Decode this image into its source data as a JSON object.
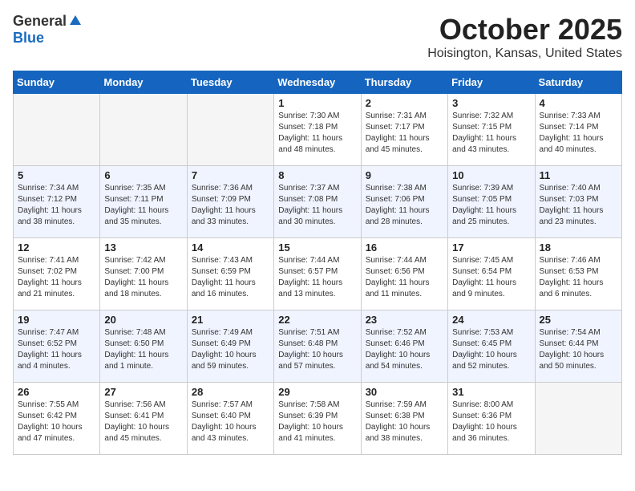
{
  "logo": {
    "general": "General",
    "blue": "Blue"
  },
  "header": {
    "month": "October 2025",
    "location": "Hoisington, Kansas, United States"
  },
  "weekdays": [
    "Sunday",
    "Monday",
    "Tuesday",
    "Wednesday",
    "Thursday",
    "Friday",
    "Saturday"
  ],
  "weeks": [
    [
      {
        "day": "",
        "info": ""
      },
      {
        "day": "",
        "info": ""
      },
      {
        "day": "",
        "info": ""
      },
      {
        "day": "1",
        "info": "Sunrise: 7:30 AM\nSunset: 7:18 PM\nDaylight: 11 hours\nand 48 minutes."
      },
      {
        "day": "2",
        "info": "Sunrise: 7:31 AM\nSunset: 7:17 PM\nDaylight: 11 hours\nand 45 minutes."
      },
      {
        "day": "3",
        "info": "Sunrise: 7:32 AM\nSunset: 7:15 PM\nDaylight: 11 hours\nand 43 minutes."
      },
      {
        "day": "4",
        "info": "Sunrise: 7:33 AM\nSunset: 7:14 PM\nDaylight: 11 hours\nand 40 minutes."
      }
    ],
    [
      {
        "day": "5",
        "info": "Sunrise: 7:34 AM\nSunset: 7:12 PM\nDaylight: 11 hours\nand 38 minutes."
      },
      {
        "day": "6",
        "info": "Sunrise: 7:35 AM\nSunset: 7:11 PM\nDaylight: 11 hours\nand 35 minutes."
      },
      {
        "day": "7",
        "info": "Sunrise: 7:36 AM\nSunset: 7:09 PM\nDaylight: 11 hours\nand 33 minutes."
      },
      {
        "day": "8",
        "info": "Sunrise: 7:37 AM\nSunset: 7:08 PM\nDaylight: 11 hours\nand 30 minutes."
      },
      {
        "day": "9",
        "info": "Sunrise: 7:38 AM\nSunset: 7:06 PM\nDaylight: 11 hours\nand 28 minutes."
      },
      {
        "day": "10",
        "info": "Sunrise: 7:39 AM\nSunset: 7:05 PM\nDaylight: 11 hours\nand 25 minutes."
      },
      {
        "day": "11",
        "info": "Sunrise: 7:40 AM\nSunset: 7:03 PM\nDaylight: 11 hours\nand 23 minutes."
      }
    ],
    [
      {
        "day": "12",
        "info": "Sunrise: 7:41 AM\nSunset: 7:02 PM\nDaylight: 11 hours\nand 21 minutes."
      },
      {
        "day": "13",
        "info": "Sunrise: 7:42 AM\nSunset: 7:00 PM\nDaylight: 11 hours\nand 18 minutes."
      },
      {
        "day": "14",
        "info": "Sunrise: 7:43 AM\nSunset: 6:59 PM\nDaylight: 11 hours\nand 16 minutes."
      },
      {
        "day": "15",
        "info": "Sunrise: 7:44 AM\nSunset: 6:57 PM\nDaylight: 11 hours\nand 13 minutes."
      },
      {
        "day": "16",
        "info": "Sunrise: 7:44 AM\nSunset: 6:56 PM\nDaylight: 11 hours\nand 11 minutes."
      },
      {
        "day": "17",
        "info": "Sunrise: 7:45 AM\nSunset: 6:54 PM\nDaylight: 11 hours\nand 9 minutes."
      },
      {
        "day": "18",
        "info": "Sunrise: 7:46 AM\nSunset: 6:53 PM\nDaylight: 11 hours\nand 6 minutes."
      }
    ],
    [
      {
        "day": "19",
        "info": "Sunrise: 7:47 AM\nSunset: 6:52 PM\nDaylight: 11 hours\nand 4 minutes."
      },
      {
        "day": "20",
        "info": "Sunrise: 7:48 AM\nSunset: 6:50 PM\nDaylight: 11 hours\nand 1 minute."
      },
      {
        "day": "21",
        "info": "Sunrise: 7:49 AM\nSunset: 6:49 PM\nDaylight: 10 hours\nand 59 minutes."
      },
      {
        "day": "22",
        "info": "Sunrise: 7:51 AM\nSunset: 6:48 PM\nDaylight: 10 hours\nand 57 minutes."
      },
      {
        "day": "23",
        "info": "Sunrise: 7:52 AM\nSunset: 6:46 PM\nDaylight: 10 hours\nand 54 minutes."
      },
      {
        "day": "24",
        "info": "Sunrise: 7:53 AM\nSunset: 6:45 PM\nDaylight: 10 hours\nand 52 minutes."
      },
      {
        "day": "25",
        "info": "Sunrise: 7:54 AM\nSunset: 6:44 PM\nDaylight: 10 hours\nand 50 minutes."
      }
    ],
    [
      {
        "day": "26",
        "info": "Sunrise: 7:55 AM\nSunset: 6:42 PM\nDaylight: 10 hours\nand 47 minutes."
      },
      {
        "day": "27",
        "info": "Sunrise: 7:56 AM\nSunset: 6:41 PM\nDaylight: 10 hours\nand 45 minutes."
      },
      {
        "day": "28",
        "info": "Sunrise: 7:57 AM\nSunset: 6:40 PM\nDaylight: 10 hours\nand 43 minutes."
      },
      {
        "day": "29",
        "info": "Sunrise: 7:58 AM\nSunset: 6:39 PM\nDaylight: 10 hours\nand 41 minutes."
      },
      {
        "day": "30",
        "info": "Sunrise: 7:59 AM\nSunset: 6:38 PM\nDaylight: 10 hours\nand 38 minutes."
      },
      {
        "day": "31",
        "info": "Sunrise: 8:00 AM\nSunset: 6:36 PM\nDaylight: 10 hours\nand 36 minutes."
      },
      {
        "day": "",
        "info": ""
      }
    ]
  ]
}
